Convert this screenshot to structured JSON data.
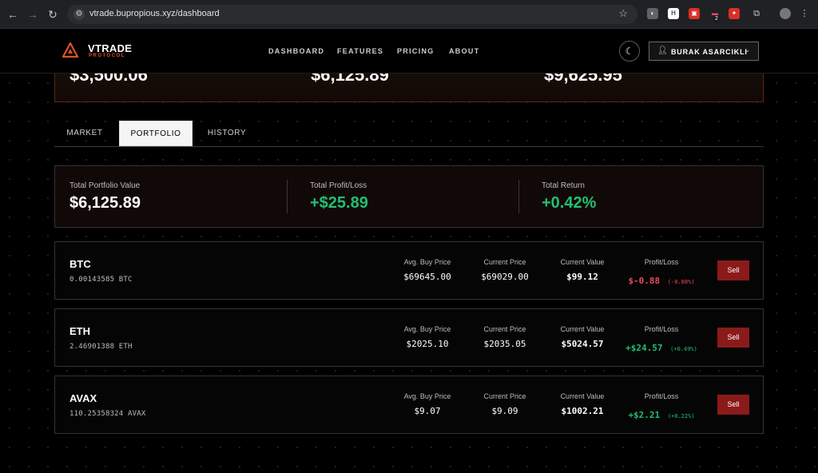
{
  "browser": {
    "url": "vtrade.bupropious.xyz/dashboard",
    "extension_badge": "2"
  },
  "brand": {
    "name": "VTRADE",
    "subtitle": "PROTOCOL",
    "accent": "#d9532b"
  },
  "nav": {
    "items": [
      "DASHBOARD",
      "FEATURES",
      "PRICING",
      "ABOUT"
    ],
    "user_name": "BURAK ASARCIKLI"
  },
  "top_card": {
    "values": [
      "$3,500.06",
      "$6,125.89",
      "$9,625.95"
    ]
  },
  "tabs": {
    "items": [
      "MARKET",
      "PORTFOLIO",
      "HISTORY"
    ],
    "active": "PORTFOLIO"
  },
  "summary": {
    "total_value_label": "Total Portfolio Value",
    "total_value": "$6,125.89",
    "profit_loss_label": "Total Profit/Loss",
    "profit_loss": "+$25.89",
    "return_label": "Total Return",
    "return": "+0.42%"
  },
  "column_headers": {
    "avg_buy": "Avg. Buy Price",
    "current_price": "Current Price",
    "current_value": "Current Value",
    "profit_loss": "Profit/Loss"
  },
  "holdings": [
    {
      "symbol": "BTC",
      "amount": "0.00143585 BTC",
      "avg_buy": "$69645.00",
      "current_price": "$69029.00",
      "current_value": "$99.12",
      "pl": "$-0.88",
      "pl_pct": "(-0.88%)",
      "positive": false,
      "sell_label": "Sell"
    },
    {
      "symbol": "ETH",
      "amount": "2.46901388 ETH",
      "avg_buy": "$2025.10",
      "current_price": "$2035.05",
      "current_value": "$5024.57",
      "pl": "+$24.57",
      "pl_pct": "(+0.49%)",
      "positive": true,
      "sell_label": "Sell"
    },
    {
      "symbol": "AVAX",
      "amount": "110.25358324 AVAX",
      "avg_buy": "$9.07",
      "current_price": "$9.09",
      "current_value": "$1002.21",
      "pl": "+$2.21",
      "pl_pct": "(+0.22%)",
      "positive": true,
      "sell_label": "Sell"
    }
  ],
  "colors": {
    "positive": "#20c073",
    "negative": "#e84a5f",
    "sell_button": "#8b1a1a"
  }
}
